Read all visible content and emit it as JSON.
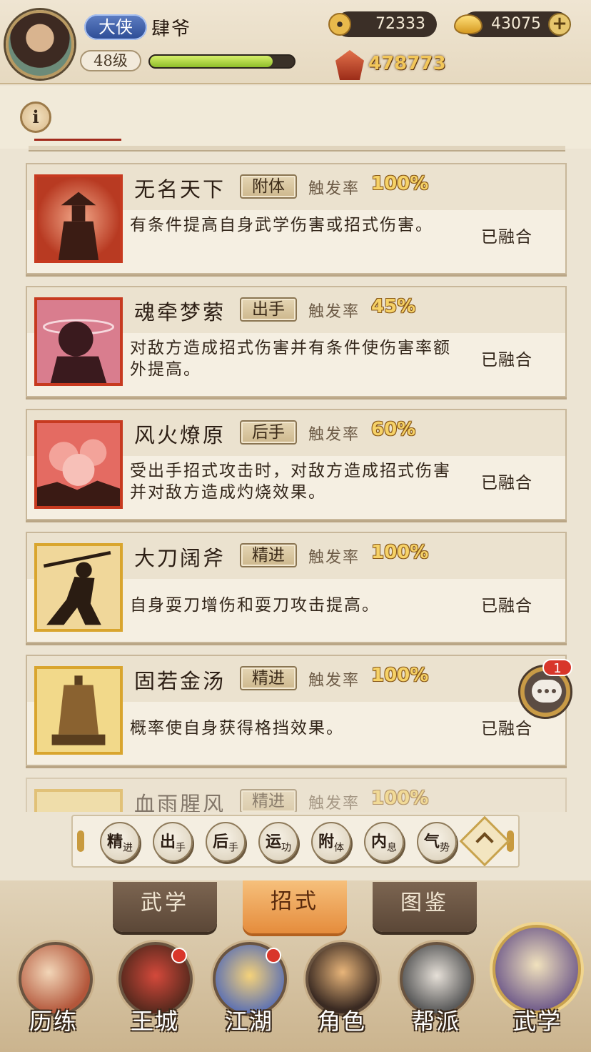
{
  "player": {
    "rank": "大侠",
    "name": "肆爷",
    "level": "48级",
    "exp_progress": 0.85
  },
  "currencies": {
    "copper": "72333",
    "gold": "43075",
    "power": "478773"
  },
  "skills": [
    {
      "name": "无名天下",
      "type": "附体",
      "rate_label": "触发率",
      "rate": "100%",
      "desc": "有条件提高自身武学伤害或招式伤害。",
      "status": "已融合",
      "icon": "straw-hat-swordsman-icon",
      "frame": "red"
    },
    {
      "name": "魂牵梦萦",
      "type": "出手",
      "rate_label": "触发率",
      "rate": "45%",
      "desc": "对敌方造成招式伤害并有条件使伤害率额外提高。",
      "status": "已融合",
      "icon": "dazed-figure-icon",
      "frame": "red"
    },
    {
      "name": "风火燎原",
      "type": "后手",
      "rate_label": "触发率",
      "rate": "60%",
      "desc": "受出手招式攻击时，对敌方造成招式伤害并对敌方造成灼烧效果。",
      "status": "已融合",
      "icon": "fire-icon",
      "frame": "red"
    },
    {
      "name": "大刀阔斧",
      "type": "精进",
      "rate_label": "触发率",
      "rate": "100%",
      "desc": "自身耍刀增伤和耍刀攻击提高。",
      "status": "已融合",
      "icon": "blade-dancer-icon",
      "frame": "gold"
    },
    {
      "name": "固若金汤",
      "type": "精进",
      "rate_label": "触发率",
      "rate": "100%",
      "desc": "概率使自身获得格挡效果。",
      "status": "已融合",
      "icon": "bell-icon",
      "frame": "gold"
    },
    {
      "name": "血雨腥风",
      "type": "精进",
      "rate_label": "触发率",
      "rate": "100%",
      "desc": "",
      "status": "",
      "icon": "blood-wind-icon",
      "frame": "gold"
    }
  ],
  "chat": {
    "badge": "1"
  },
  "filters": [
    {
      "main": "精",
      "sub": "进"
    },
    {
      "main": "出",
      "sub": "手"
    },
    {
      "main": "后",
      "sub": "手"
    },
    {
      "main": "运",
      "sub": "功"
    },
    {
      "main": "附",
      "sub": "体"
    },
    {
      "main": "内",
      "sub": "息"
    },
    {
      "main": "气",
      "sub": "势"
    }
  ],
  "sub_tabs": [
    "武学",
    "招式",
    "图鉴"
  ],
  "active_sub_tab": "招式",
  "nav": [
    {
      "label": "历练",
      "icon": "training-icon",
      "dot": false
    },
    {
      "label": "王城",
      "icon": "royal-city-icon",
      "dot": true
    },
    {
      "label": "江湖",
      "icon": "jianghu-icon",
      "dot": true
    },
    {
      "label": "角色",
      "icon": "character-icon",
      "dot": false
    },
    {
      "label": "帮派",
      "icon": "guild-icon",
      "dot": false
    },
    {
      "label": "武学",
      "icon": "martial-arts-scroll-icon",
      "dot": false,
      "active": true
    }
  ],
  "colors": {
    "accent_orange": "#e58c3c",
    "rate_gold": "#f6d267",
    "frame_red": "#c73a20",
    "frame_gold": "#d9a52e",
    "badge_red": "#d8362a"
  }
}
